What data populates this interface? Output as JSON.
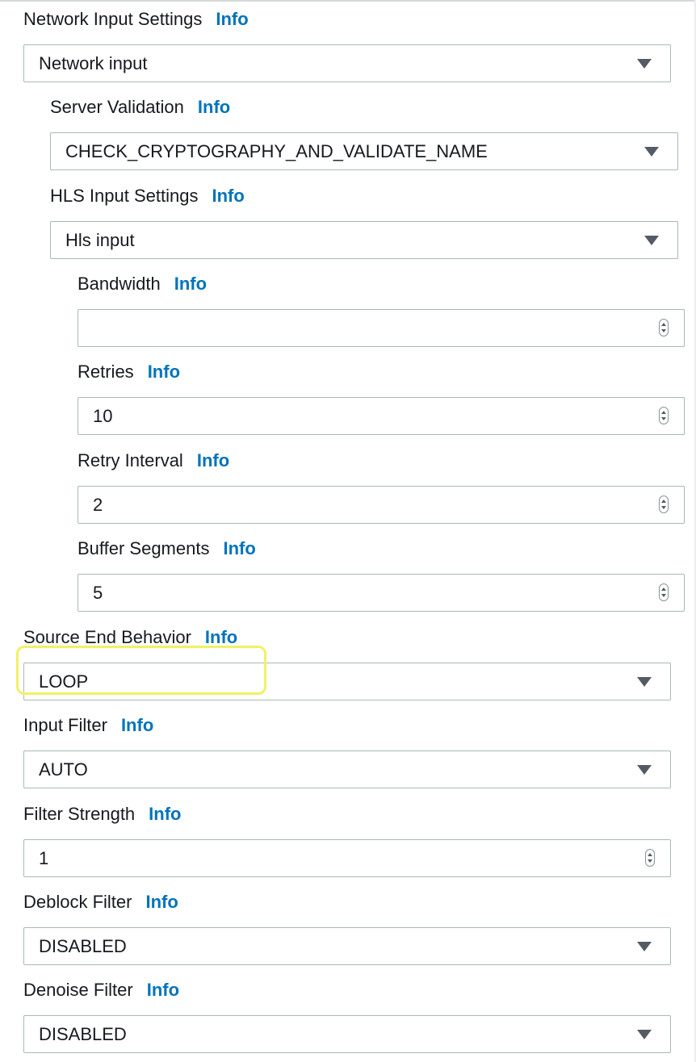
{
  "info_label": "Info",
  "network_input_settings": {
    "label": "Network Input Settings",
    "value": "Network input"
  },
  "server_validation": {
    "label": "Server Validation",
    "value": "CHECK_CRYPTOGRAPHY_AND_VALIDATE_NAME"
  },
  "hls_input_settings": {
    "label": "HLS Input Settings",
    "value": "Hls input"
  },
  "bandwidth": {
    "label": "Bandwidth",
    "value": ""
  },
  "retries": {
    "label": "Retries",
    "value": "10"
  },
  "retry_interval": {
    "label": "Retry Interval",
    "value": "2"
  },
  "buffer_segments": {
    "label": "Buffer Segments",
    "value": "5"
  },
  "source_end_behavior": {
    "label": "Source End Behavior",
    "value": "LOOP"
  },
  "input_filter": {
    "label": "Input Filter",
    "value": "AUTO"
  },
  "filter_strength": {
    "label": "Filter Strength",
    "value": "1"
  },
  "deblock_filter": {
    "label": "Deblock Filter",
    "value": "DISABLED"
  },
  "denoise_filter": {
    "label": "Denoise Filter",
    "value": "DISABLED"
  },
  "colors": {
    "info_link": "#0073bb",
    "highlight": "#f1f165",
    "border": "#aab7b8",
    "caret": "#545b64"
  }
}
